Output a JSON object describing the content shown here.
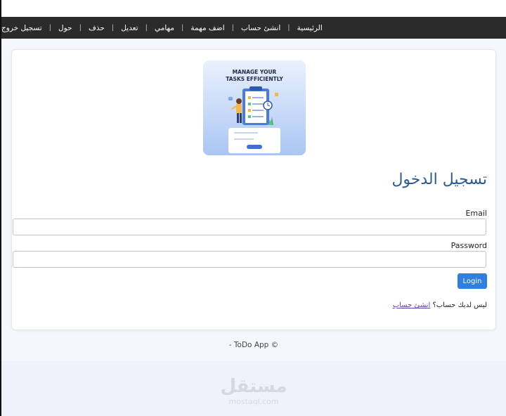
{
  "nav": {
    "items": [
      "الرئيسية",
      "انشئ حساب",
      "اضف مهمة",
      "مهامي",
      "تعديل",
      "حذف",
      "حول",
      "تسجيل خروج"
    ]
  },
  "hero": {
    "line1": "MANAGE YOUR",
    "line2": "TASKS EFFICIENTLY",
    "icon": "task-clipboard-illustration"
  },
  "login": {
    "title": "تسجيل الدخول",
    "email_label": "Email",
    "email_value": "",
    "password_label": "Password",
    "password_value": "",
    "button": "Login",
    "no_account": "ليس لديك حساب؟",
    "signup_link": "انشئ حساب"
  },
  "footer": {
    "text": "- ToDo App ©"
  },
  "watermark": {
    "arabic": "مستقل",
    "latin": "mostaql.com"
  },
  "colors": {
    "navbar": "#2b2b2b",
    "title": "#2c5a94",
    "button": "#2f7fe2",
    "link": "#6a3fa5"
  }
}
